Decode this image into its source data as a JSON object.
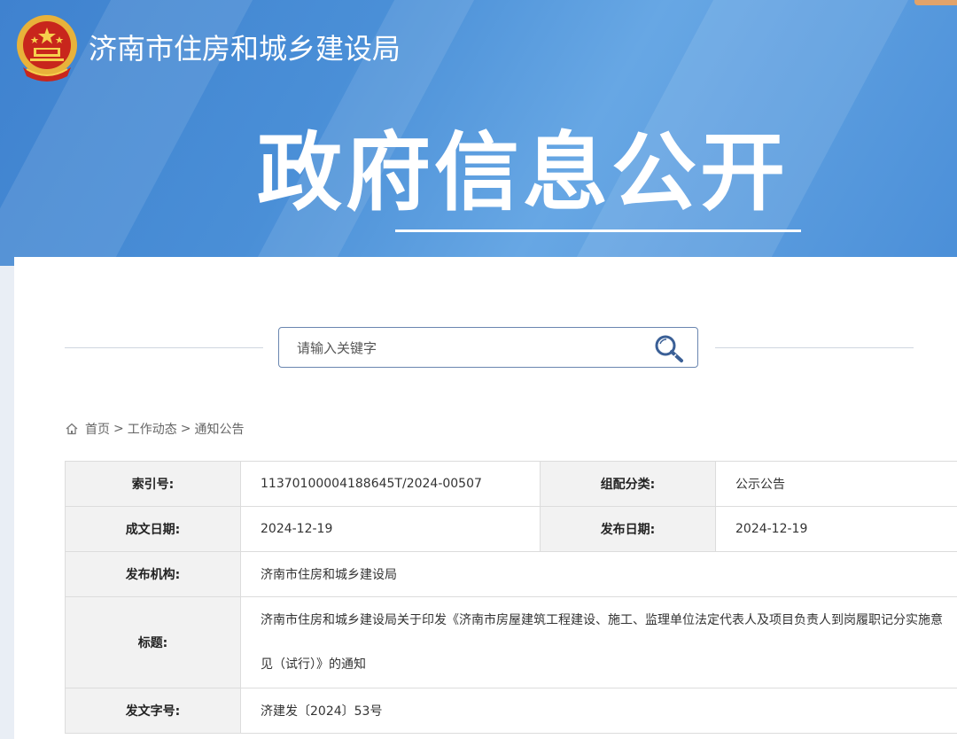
{
  "header": {
    "site_name": "济南市住房和城乡建设局",
    "banner_title": "政府信息公开"
  },
  "search": {
    "placeholder": "请输入关键字"
  },
  "breadcrumb": {
    "home": "首页",
    "sep1": ">",
    "section": "工作动态",
    "sep2": ">",
    "current": "通知公告"
  },
  "meta": {
    "index_label": "索引号:",
    "index_value": "11370100004188645T/2024-00507",
    "category_label": "组配分类:",
    "category_value": "公示公告",
    "written_date_label": "成文日期:",
    "written_date_value": "2024-12-19",
    "publish_date_label": "发布日期:",
    "publish_date_value": "2024-12-19",
    "agency_label": "发布机构:",
    "agency_value": "济南市住房和城乡建设局",
    "title_label": "标题:",
    "title_value": "济南市住房和城乡建设局关于印发《济南市房屋建筑工程建设、施工、监理单位法定代表人及项目负责人到岗履职记分实施意见（试行）》的通知",
    "doc_no_label": "发文字号:",
    "doc_no_value": "济建发〔2024〕53号"
  },
  "icons": {
    "emblem": "national-emblem-icon",
    "search": "search-icon",
    "home": "home-icon"
  },
  "colors": {
    "banner_blue": "#4a8fd7",
    "label_bg": "#f2f2f2",
    "border": "#dcdcdc"
  }
}
